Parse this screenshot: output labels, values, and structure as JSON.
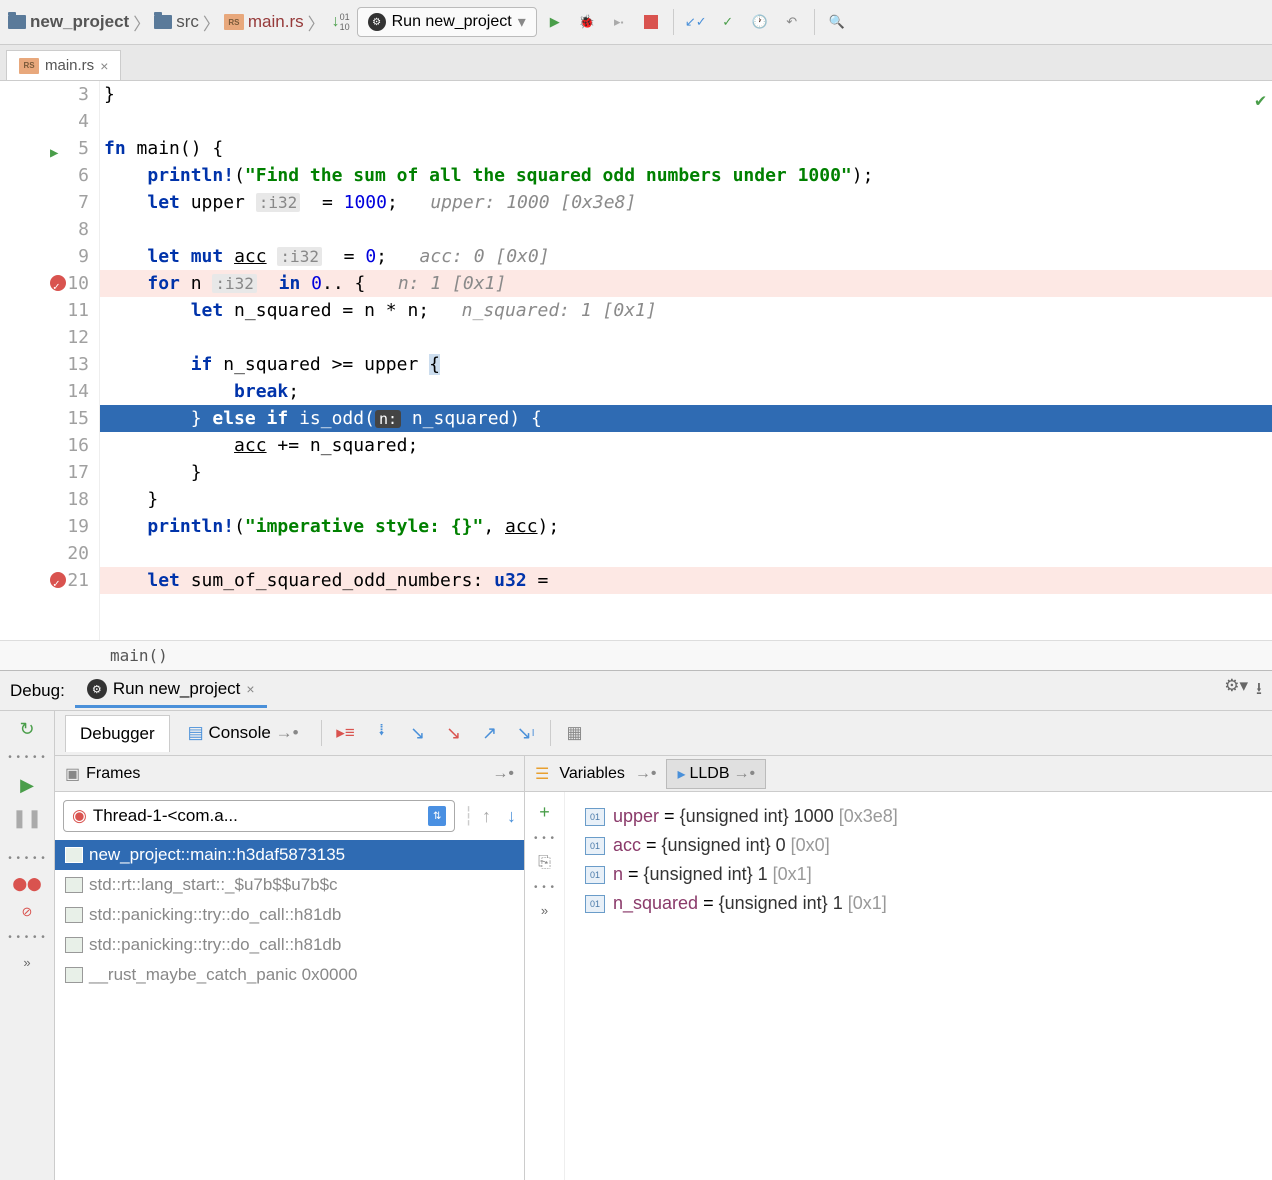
{
  "breadcrumb": {
    "project": "new_project",
    "src": "src",
    "file": "main.rs"
  },
  "runConfig": {
    "label": "Run new_project"
  },
  "editorTab": {
    "file": "main.rs"
  },
  "code": {
    "lines": [
      {
        "n": "3",
        "html": "}"
      },
      {
        "n": "4",
        "html": ""
      },
      {
        "n": "5",
        "html": "<span class='kw'>fn</span> main() {",
        "play": true
      },
      {
        "n": "6",
        "html": "    <span class='macro'>println!</span>(<span class='str'>\"Find the sum of all the squared odd numbers under 1000\"</span>);"
      },
      {
        "n": "7",
        "html": "    <span class='kw'>let</span> upper <span class='type-hint'>:i32</span>  = <span class='num'>1000</span>;   <span class='inlay'>upper: 1000 [0x3e8]</span>"
      },
      {
        "n": "8",
        "html": ""
      },
      {
        "n": "9",
        "html": "    <span class='kw'>let mut</span> <span class='underline'>acc</span> <span class='type-hint'>:i32</span>  = <span class='num'>0</span>;   <span class='inlay'>acc: 0 [0x0]</span>"
      },
      {
        "n": "10",
        "html": "    <span class='kw'>for</span> n <span class='type-hint'>:i32</span>  <span class='kw'>in</span> <span class='num'>0</span>.. {   <span class='inlay'>n: 1 [0x1]</span>",
        "bp": true,
        "cls": "hl-breakpoint"
      },
      {
        "n": "11",
        "html": "        <span class='kw'>let</span> n_squared = n * n;   <span class='inlay'>n_squared: 1 [0x1]</span>"
      },
      {
        "n": "12",
        "html": ""
      },
      {
        "n": "13",
        "html": "        <span class='kw'>if</span> n_squared >= upper <span style='background:#cde'>{</span>"
      },
      {
        "n": "14",
        "html": "            <span class='kw'>break</span>;"
      },
      {
        "n": "15",
        "html": "        } <span class='kw'>else if</span> is_odd(<span class='param-hint'>n:</span> n_squared) {",
        "cls": "hl-current"
      },
      {
        "n": "16",
        "html": "            <span class='underline'>acc</span> += n_squared;"
      },
      {
        "n": "17",
        "html": "        }"
      },
      {
        "n": "18",
        "html": "    }"
      },
      {
        "n": "19",
        "html": "    <span class='macro'>println!</span>(<span class='str'>\"imperative style: {}\"</span>, <span class='underline'>acc</span>);"
      },
      {
        "n": "20",
        "html": ""
      },
      {
        "n": "21",
        "html": "    <span class='kw'>let</span> sum_of_squared_odd_numbers: <span class='type'>u32</span> =",
        "bp": true,
        "cls": "hl-breakpoint"
      }
    ]
  },
  "breadcrumbBottom": "main()",
  "debug": {
    "label": "Debug:",
    "tabLabel": "Run new_project",
    "debuggerTab": "Debugger",
    "consoleTab": "Console",
    "framesLabel": "Frames",
    "variablesLabel": "Variables",
    "lldbLabel": "LLDB",
    "threadLabel": "Thread-1-<com.a...",
    "frames": [
      {
        "label": "new_project::main::h3daf5873135",
        "selected": true
      },
      {
        "label": "std::rt::lang_start::_$u7b$$u7b$c"
      },
      {
        "label": "std::panicking::try::do_call::h81db"
      },
      {
        "label": "std::panicking::try::do_call::h81db"
      },
      {
        "label": "__rust_maybe_catch_panic 0x0000"
      }
    ],
    "variables": [
      {
        "name": "upper",
        "type": "{unsigned int}",
        "val": "1000",
        "hex": "[0x3e8]"
      },
      {
        "name": "acc",
        "type": "{unsigned int}",
        "val": "0",
        "hex": "[0x0]"
      },
      {
        "name": "n",
        "type": "{unsigned int}",
        "val": "1",
        "hex": "[0x1]"
      },
      {
        "name": "n_squared",
        "type": "{unsigned int}",
        "val": "1",
        "hex": "[0x1]"
      }
    ]
  }
}
